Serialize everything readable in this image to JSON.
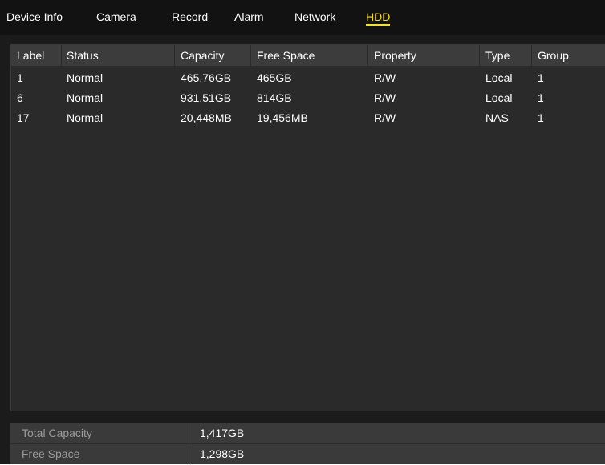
{
  "tabs": [
    {
      "label": "Device Info"
    },
    {
      "label": "Camera"
    },
    {
      "label": "Record"
    },
    {
      "label": "Alarm"
    },
    {
      "label": "Network"
    },
    {
      "label": "HDD",
      "active": true
    }
  ],
  "table": {
    "headers": [
      "Label",
      "Status",
      "Capacity",
      "Free Space",
      "Property",
      "Type",
      "Group"
    ],
    "rows": [
      [
        "1",
        "Normal",
        "465.76GB",
        "465GB",
        "R/W",
        "Local",
        "1"
      ],
      [
        "6",
        "Normal",
        "931.51GB",
        "814GB",
        "R/W",
        "Local",
        "1"
      ],
      [
        "17",
        "Normal",
        "20,448MB",
        "19,456MB",
        "R/W",
        "NAS",
        "1"
      ]
    ]
  },
  "summary": {
    "total_capacity_label": "Total Capacity",
    "total_capacity_value": "1,417GB",
    "free_space_label": "Free Space",
    "free_space_value": "1,298GB"
  },
  "colors": {
    "background": "#1b1b1b",
    "header": "#3c3c3c",
    "active_tab": "#ffe400"
  }
}
